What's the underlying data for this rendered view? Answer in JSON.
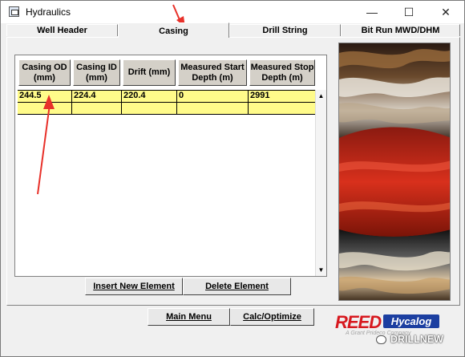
{
  "window": {
    "title": "Hydraulics",
    "controls": {
      "minimize": "—",
      "maximize": "☐",
      "close": "✕"
    }
  },
  "tabs": [
    {
      "label": "Well Header"
    },
    {
      "label": "Casing"
    },
    {
      "label": "Drill String"
    },
    {
      "label": "Bit Run MWD/DHM"
    }
  ],
  "active_tab": "Casing",
  "grid": {
    "columns": [
      {
        "line1": "Casing OD",
        "line2": "(mm)"
      },
      {
        "line1": "Casing ID",
        "line2": "(mm)"
      },
      {
        "line1": "Drift (mm)",
        "line2": ""
      },
      {
        "line1": "Measured Start",
        "line2": "Depth (m)"
      },
      {
        "line1": "Measured Stop",
        "line2": "Depth (m)"
      }
    ],
    "rows": [
      [
        "244.5",
        "224.4",
        "220.4",
        "0",
        "2991"
      ],
      [
        "",
        "",
        "",
        "",
        ""
      ]
    ],
    "scroll_up": "▲",
    "scroll_down": "▼"
  },
  "buttons": {
    "insert": "Insert New Element",
    "delete": "Delete Element",
    "main_menu": "Main Menu",
    "calc": "Calc/Optimize"
  },
  "logo": {
    "reed": "REED",
    "hycalog": "Hycalog",
    "tagline": "A Grant Prideco Company"
  },
  "watermark": "DRILLNEW",
  "colors": {
    "grid_row": "#fffb8a",
    "header_bg": "#d4d0c8",
    "logo_red": "#d7191f",
    "logo_blue": "#1c3fa1",
    "annotation_arrow": "#e8312a"
  }
}
